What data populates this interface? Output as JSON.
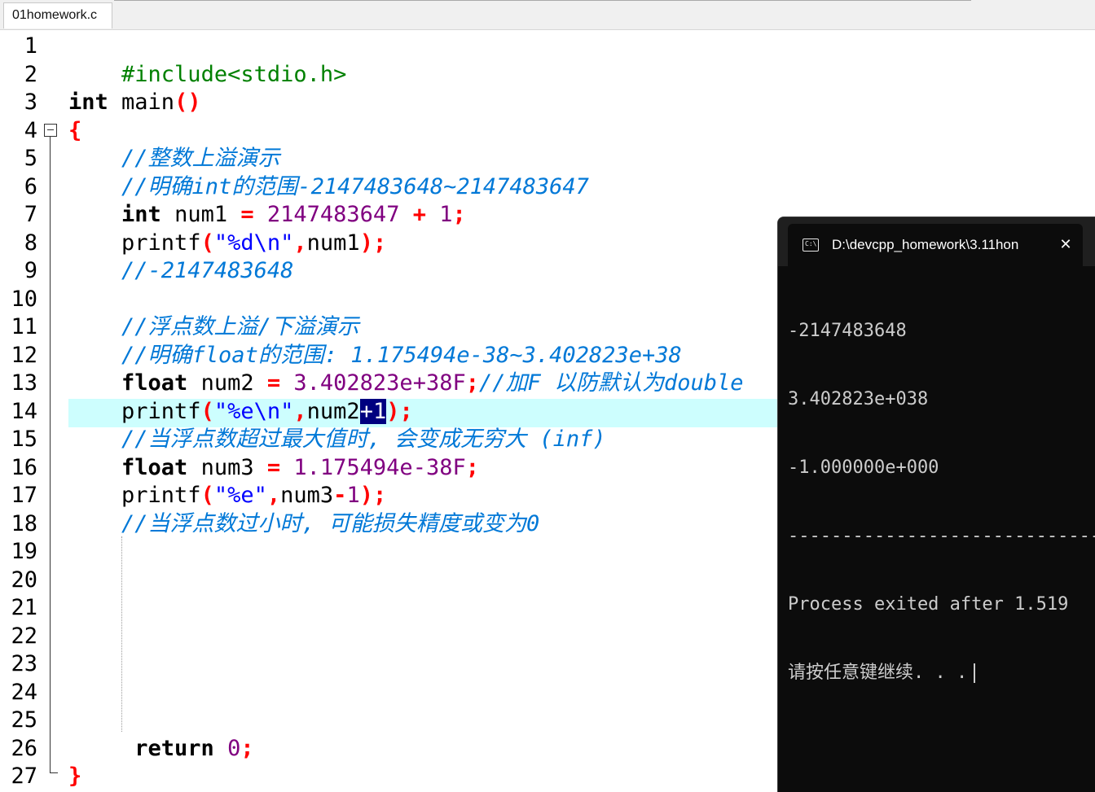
{
  "editor": {
    "tab_title": "01homework.c",
    "line_numbers": [
      "1",
      "2",
      "3",
      "4",
      "5",
      "6",
      "7",
      "8",
      "9",
      "10",
      "11",
      "12",
      "13",
      "14",
      "15",
      "16",
      "17",
      "18",
      "19",
      "20",
      "21",
      "22",
      "23",
      "24",
      "25",
      "26",
      "27"
    ],
    "code": {
      "l1_include": "#include<stdio.h>",
      "l3_int": "int",
      "l3_main": " main",
      "l3_parens": "()",
      "l4_open": "{",
      "l5_comment": "//整数上溢演示",
      "l6_comment": "//明确int的范围-2147483648~2147483647",
      "l7_int": "int",
      "l7_var": " num1 ",
      "l7_eq": "=",
      "l7_sp": " ",
      "l7_num": "2147483647",
      "l7_plus": " + ",
      "l7_one": "1",
      "l7_semi": ";",
      "l8_fn": "printf",
      "l8_open": "(",
      "l8_str": "\"%d\\n\"",
      "l8_comma": ",",
      "l8_var": "num1",
      "l8_close": ");",
      "l9_comment": "//-2147483648",
      "l11_comment": "//浮点数上溢/下溢演示",
      "l12_comment": "//明确float的范围: 1.175494e-38~3.402823e+38",
      "l13_float": "float",
      "l13_var": " num2 ",
      "l13_eq": "=",
      "l13_sp": " ",
      "l13_num": "3.402823e+38F",
      "l13_semi": ";",
      "l13_comment": "//加F 以防默认为double",
      "l14_fn": "printf",
      "l14_open": "(",
      "l14_str": "\"%e\\n\"",
      "l14_comma": ",",
      "l14_var": "num2",
      "l14_sel": "+1",
      "l14_close": ");",
      "l15_comment": "//当浮点数超过最大值时, 会变成无穷大 (inf)",
      "l16_float": "float",
      "l16_var": " num3 ",
      "l16_eq": "=",
      "l16_sp": " ",
      "l16_num": "1.175494e-38F",
      "l16_semi": ";",
      "l17_fn": "printf",
      "l17_open": "(",
      "l17_str": "\"%e\"",
      "l17_comma": ",",
      "l17_var": "num3",
      "l17_minus": "-",
      "l17_one": "1",
      "l17_close": ");",
      "l18_comment": "//当浮点数过小时, 可能损失精度或变为0",
      "l26_return": "return",
      "l26_sp": " ",
      "l26_zero": "0",
      "l26_semi": ";",
      "l27_close": "}"
    }
  },
  "console": {
    "title": "D:\\devcpp_homework\\3.11hon",
    "icon_label": "C:\\",
    "output": [
      "-2147483648",
      "3.402823e+038",
      "-1.000000e+000",
      "----------------------------------------",
      "Process exited after 1.519",
      "请按任意键继续. . ."
    ]
  },
  "colors": {
    "preprocessor": "#008000",
    "keyword": "#000000",
    "punctuation": "#ff0000",
    "number": "#800080",
    "string": "#0000ff",
    "comment": "#0078d7",
    "current_line": "#cdfefe",
    "selection": "#000080",
    "console_bg": "#0c0c0c"
  }
}
